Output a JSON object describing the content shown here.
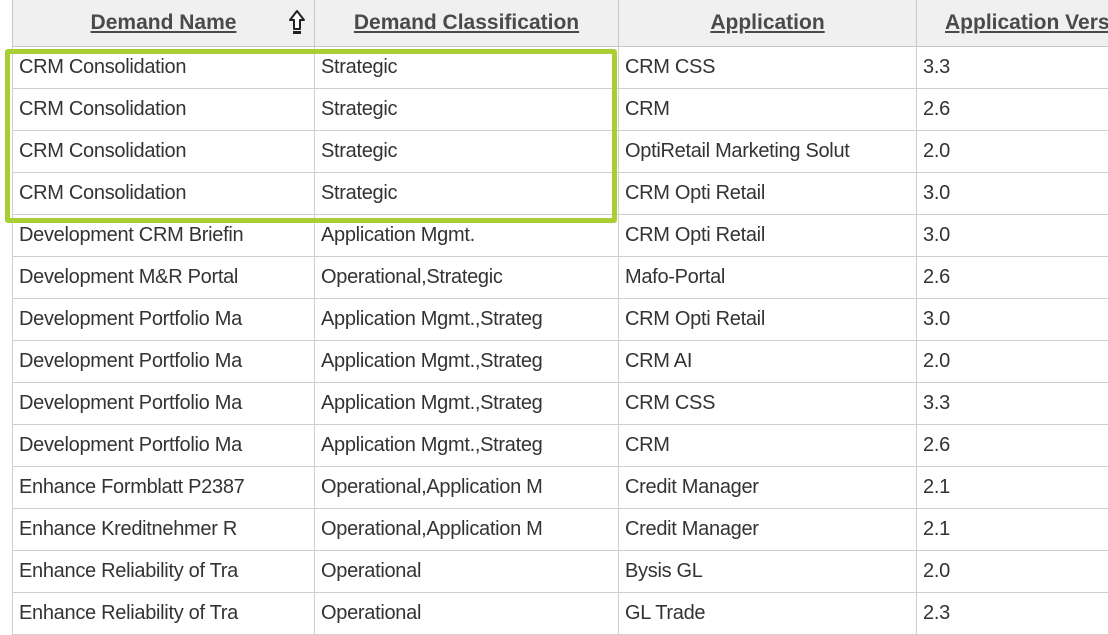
{
  "table": {
    "columns": [
      {
        "label": "Demand Name",
        "sorted": "ascending"
      },
      {
        "label": "Demand Classification"
      },
      {
        "label": "Application"
      },
      {
        "label": "Application Version"
      }
    ],
    "rows": [
      [
        "CRM Consolidation",
        "Strategic",
        "CRM CSS",
        "3.3"
      ],
      [
        "CRM Consolidation",
        "Strategic",
        "CRM",
        "2.6"
      ],
      [
        "CRM Consolidation",
        "Strategic",
        "OptiRetail Marketing Solut",
        "2.0"
      ],
      [
        "CRM Consolidation",
        "Strategic",
        "CRM Opti Retail",
        "3.0"
      ],
      [
        "Development CRM Briefin",
        "Application Mgmt.",
        "CRM Opti Retail",
        "3.0"
      ],
      [
        "Development M&R Portal",
        "Operational,Strategic",
        "Mafo-Portal",
        "2.6"
      ],
      [
        "Development Portfolio Ma",
        "Application Mgmt.,Strateg",
        "CRM Opti Retail",
        "3.0"
      ],
      [
        "Development Portfolio Ma",
        "Application Mgmt.,Strateg",
        "CRM AI",
        "2.0"
      ],
      [
        "Development Portfolio Ma",
        "Application Mgmt.,Strateg",
        "CRM CSS",
        "3.3"
      ],
      [
        "Development Portfolio Ma",
        "Application Mgmt.,Strateg",
        "CRM",
        "2.6"
      ],
      [
        "Enhance Formblatt P2387",
        "Operational,Application M",
        "Credit Manager",
        "2.1"
      ],
      [
        "Enhance Kreditnehmer R",
        "Operational,Application M",
        "Credit Manager",
        "2.1"
      ],
      [
        "Enhance Reliability of Tra",
        "Operational",
        "Bysis GL",
        "2.0"
      ],
      [
        "Enhance Reliability of Tra",
        "Operational",
        "GL Trade",
        "2.3"
      ]
    ]
  },
  "sort_icon": "sort-ascending-arrow-icon",
  "highlight_color": "#a9cd35"
}
